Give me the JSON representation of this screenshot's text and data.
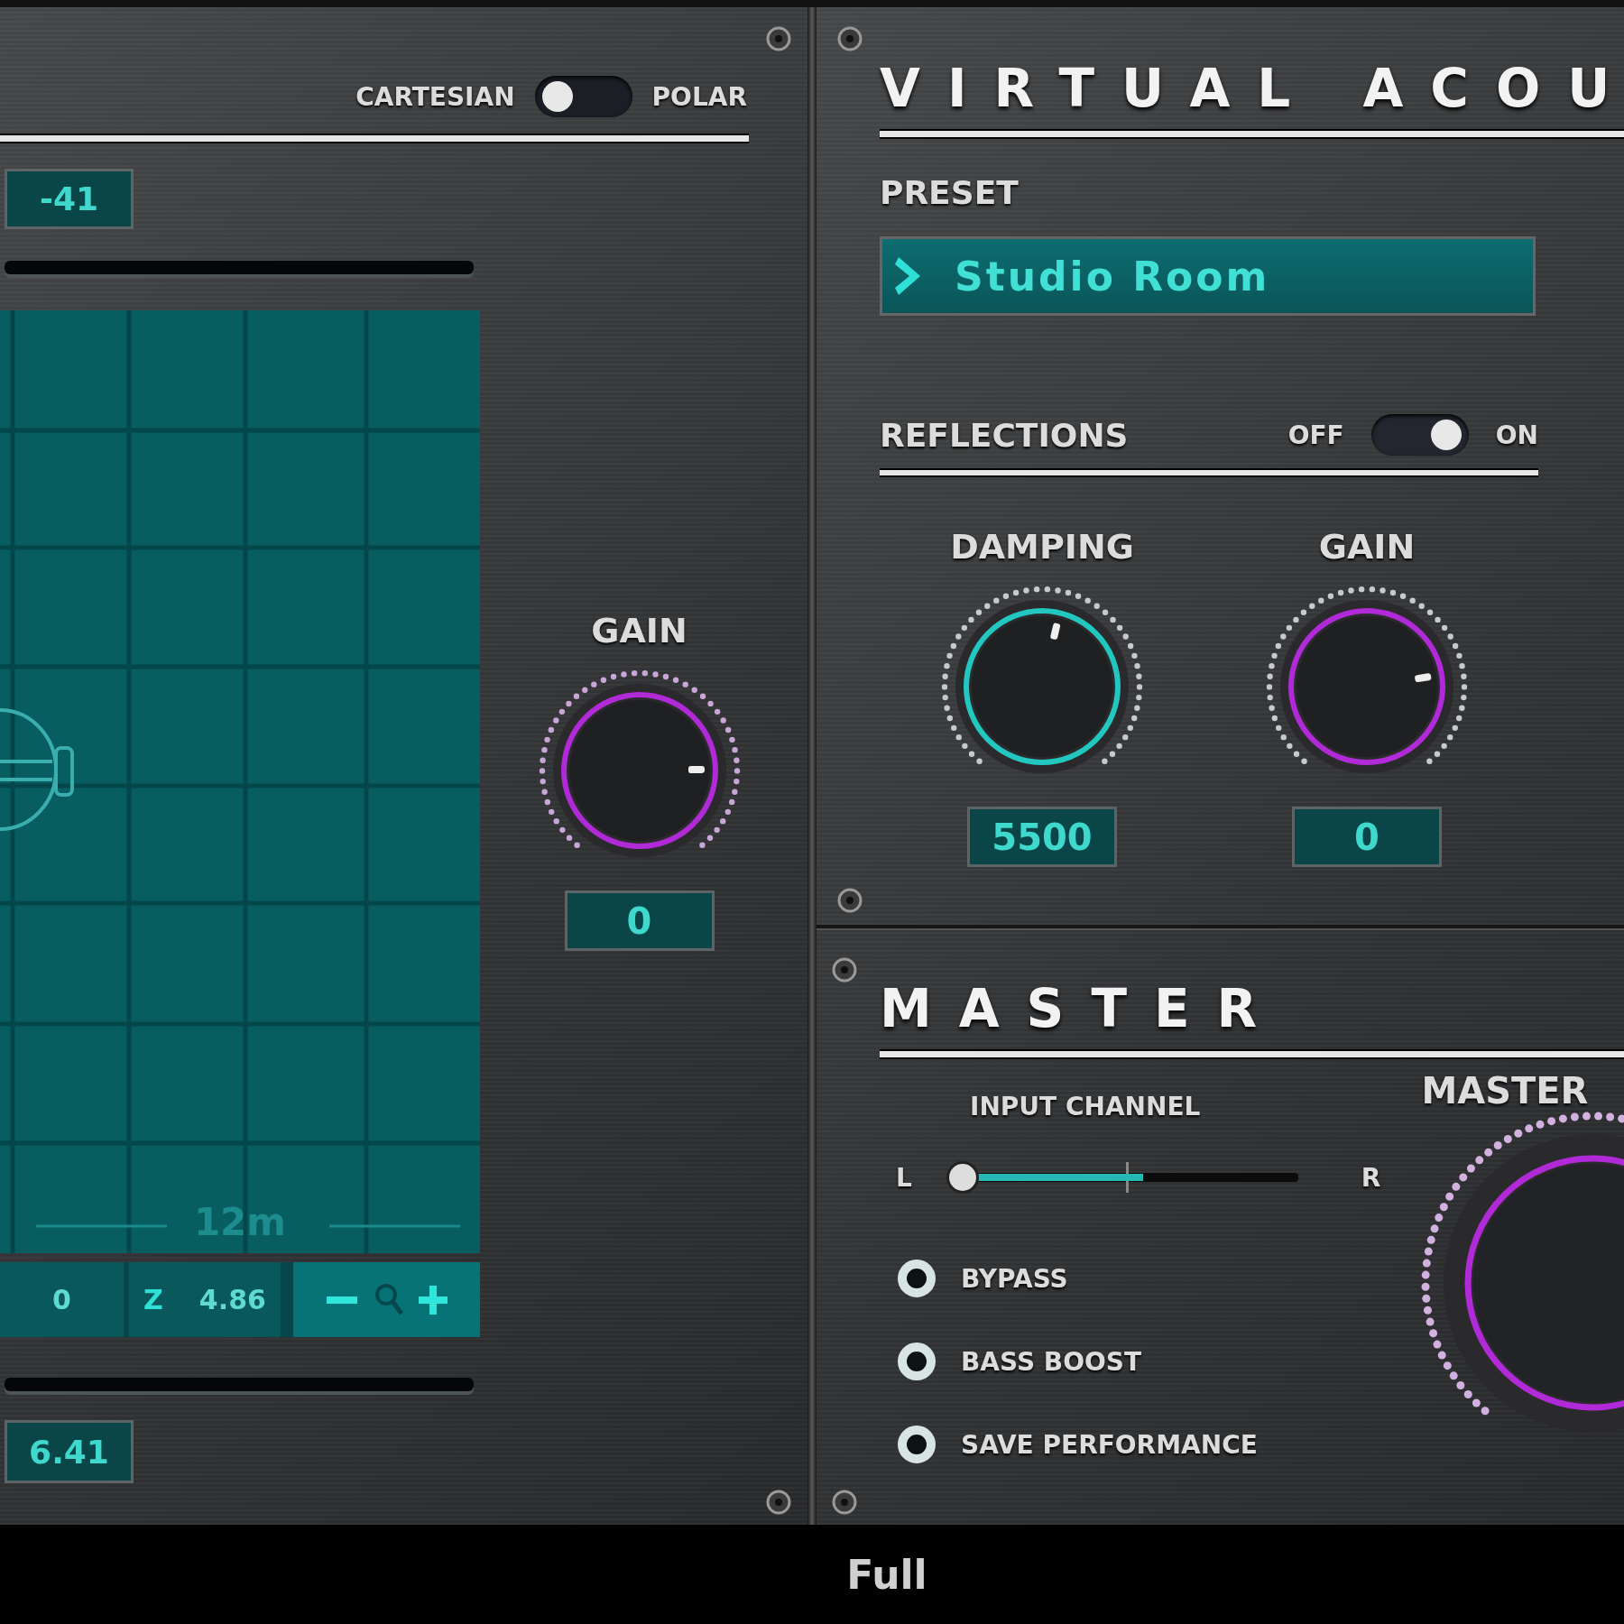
{
  "position_panel": {
    "mode_toggle": {
      "left_label": "CARTESIAN",
      "right_label": "POLAR",
      "on": false
    },
    "top_value": "-41",
    "room_grid": {
      "size_label": "12m"
    },
    "coordinates": [
      {
        "value": "0"
      },
      {
        "label": "Z",
        "value": "4.86"
      }
    ],
    "bottom_value": "6.41",
    "gain": {
      "label": "GAIN",
      "level": 0.83,
      "value": "0"
    }
  },
  "virtual_acoustics": {
    "title": "VIRTUAL ACOU",
    "preset": {
      "label": "PRESET",
      "value": "Studio Room"
    },
    "reflections": {
      "label": "REFLECTIONS",
      "off_label": "OFF",
      "on_label": "ON",
      "on": true
    },
    "knobs": [
      {
        "label": "DAMPING",
        "level": 0.55,
        "color": "#22c7c0",
        "value": "5500"
      },
      {
        "label": "GAIN",
        "level": 0.8,
        "color": "#b02ad8",
        "value": "0"
      }
    ]
  },
  "master": {
    "title": "MASTER",
    "input_channel": {
      "label": "INPUT CHANNEL",
      "left": "L",
      "right": "R",
      "level": 0.02
    },
    "options": [
      {
        "label": "BYPASS",
        "checked": false
      },
      {
        "label": "BASS BOOST",
        "checked": false
      },
      {
        "label": "SAVE PERFORMANCE",
        "checked": false
      }
    ],
    "master_knob_label": "MASTER"
  },
  "status_bar": {
    "mode": "Full"
  }
}
